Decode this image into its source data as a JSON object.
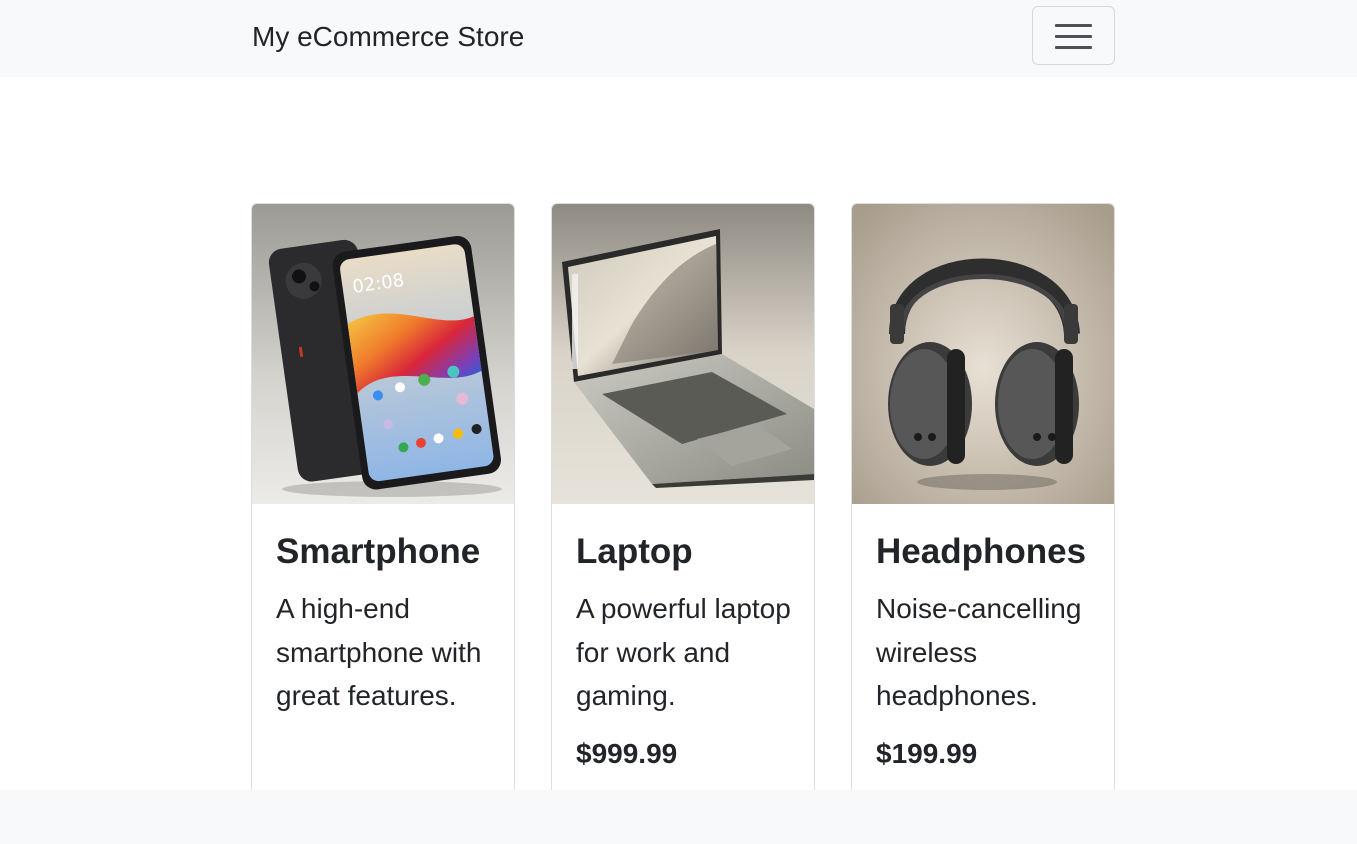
{
  "navbar": {
    "brand": "My eCommerce Store",
    "toggler_icon": "hamburger-menu-icon"
  },
  "products": [
    {
      "title": "Smartphone",
      "description": "A high-end smartphone with great features.",
      "price": "",
      "image_icon": "smartphone-image",
      "screen_time": "02:08"
    },
    {
      "title": "Laptop",
      "description": "A powerful laptop for work and gaming.",
      "price": "$999.99",
      "image_icon": "laptop-image"
    },
    {
      "title": "Headphones",
      "description": "Noise-cancelling wireless headphones.",
      "price": "$199.99",
      "image_icon": "headphones-image"
    }
  ],
  "colors": {
    "navbar_bg": "#f8f9fa",
    "text": "#212529",
    "card_border": "#dcdfe2"
  }
}
